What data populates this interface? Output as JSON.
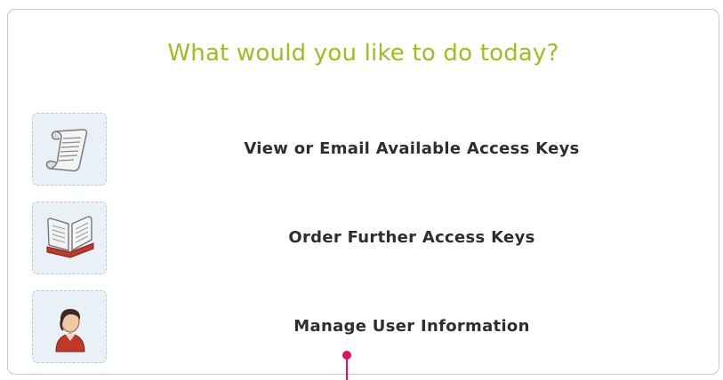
{
  "panel": {
    "heading": "What would you like to do today?",
    "accent_color": "#9cbf1d",
    "options": [
      {
        "icon": "scroll-icon",
        "label": "View or Email Available Access Keys"
      },
      {
        "icon": "open-book-icon",
        "label": "Order Further Access Keys"
      },
      {
        "icon": "user-icon",
        "label": "Manage User Information"
      }
    ]
  },
  "marker": {
    "icon": "pink-pin-icon",
    "color": "#e0105c"
  }
}
